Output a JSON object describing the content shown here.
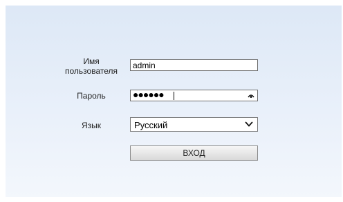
{
  "login": {
    "username_label": "Имя пользователя",
    "username_value": "admin",
    "password_label": "Пароль",
    "password_mask": "●●●●●●",
    "language_label": "Язык",
    "language_value": "Русский",
    "submit_label": "ВХОД"
  },
  "icons": {
    "password_toggle": "eye-icon",
    "language_dropdown": "chevron-down-icon"
  },
  "colors": {
    "panel_top": "#dde8f6",
    "panel_bottom": "#f3f7fc"
  }
}
